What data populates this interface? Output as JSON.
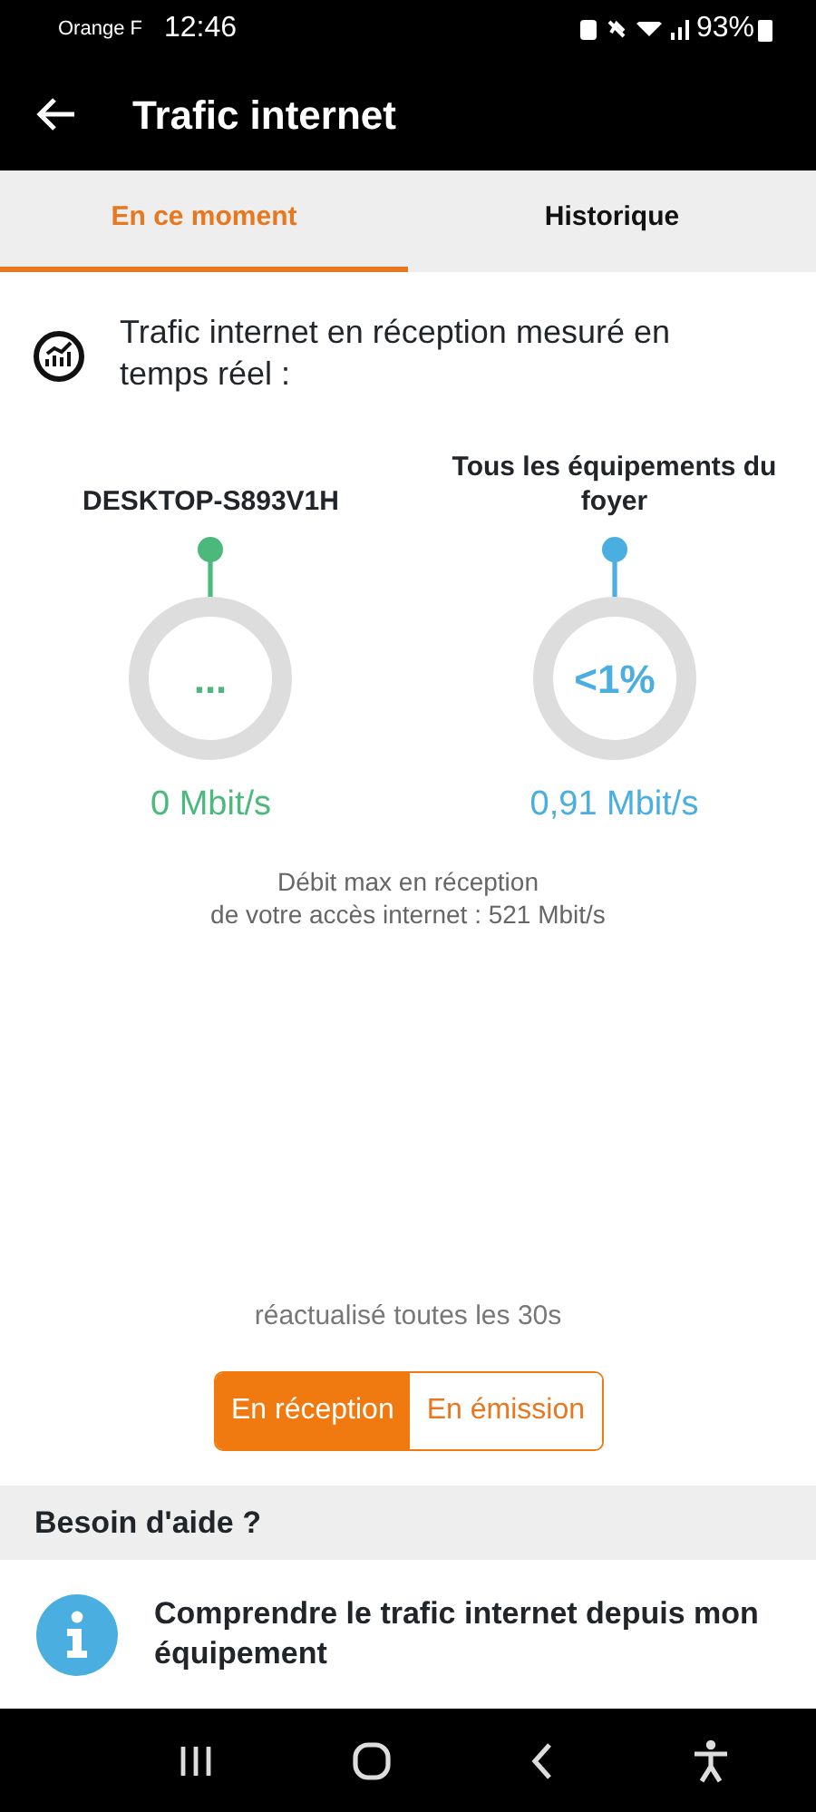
{
  "status_bar": {
    "carrier": "Orange F",
    "time": "12:46",
    "battery": "93%"
  },
  "app_bar": {
    "title": "Trafic internet"
  },
  "tabs": [
    {
      "label": "En ce moment",
      "selected": true
    },
    {
      "label": "Historique",
      "selected": false
    }
  ],
  "headline": "Trafic internet en réception mesuré en temps réel :",
  "gauges": [
    {
      "label": "DESKTOP-S893V1H",
      "center": "...",
      "reading": "0 Mbit/s",
      "color": "#4cb97c"
    },
    {
      "label": "Tous les équipements du foyer",
      "center": "<1%",
      "reading": "0,91 Mbit/s",
      "color": "#4aaee0"
    }
  ],
  "max_note": "Débit max en réception\nde votre accès internet : 521 Mbit/s",
  "refresh_note": "réactualisé toutes les 30s",
  "direction_toggle": [
    {
      "label": "En réception",
      "selected": true
    },
    {
      "label": "En émission",
      "selected": false
    }
  ],
  "help": {
    "title": "Besoin d'aide ?",
    "items": [
      {
        "text": "Comprendre le trafic internet depuis mon équipement"
      }
    ]
  }
}
